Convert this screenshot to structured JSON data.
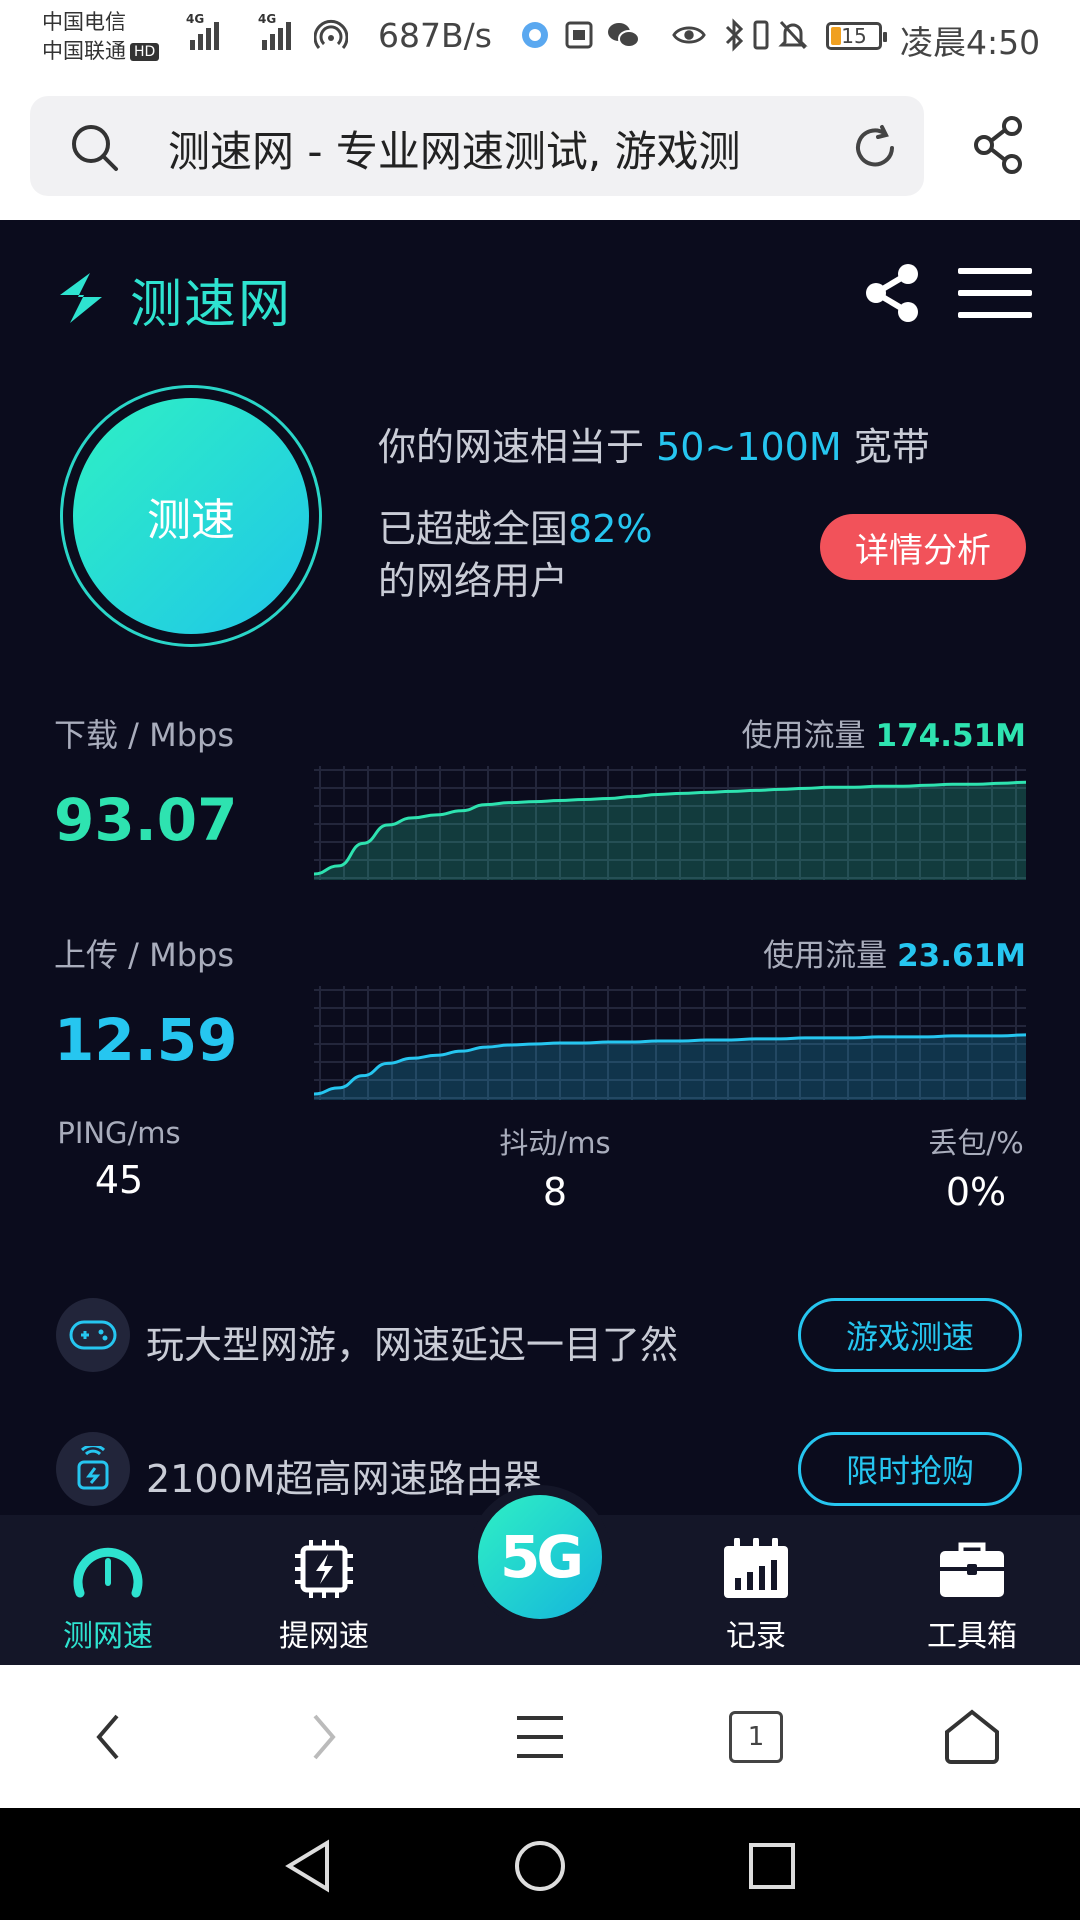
{
  "status_bar": {
    "carrier1": "中国电信",
    "carrier2": "中国联通",
    "hd": "HD",
    "net1": "4G",
    "net2": "4G",
    "speed": "687B/s",
    "battery": "15",
    "time": "凌晨4:50"
  },
  "browser": {
    "url_text": "测速网 - 专业网速测试, 游戏测",
    "tab_count": "1"
  },
  "header": {
    "logo_text": "测速网"
  },
  "summary": {
    "start_button": "测速",
    "rate_prefix": "你的网速相当于",
    "rate_value": "50~100M",
    "rate_suffix": "宽带",
    "beat_prefix": "已超越全国",
    "beat_pct": "82%",
    "beat_suffix": "的网络用户",
    "detail_button": "详情分析"
  },
  "download": {
    "label": "下载 / Mbps",
    "value": "93.07",
    "usage_label": "使用流量",
    "usage_value": "174.51M",
    "color": "#2ee3b0",
    "series": [
      0,
      8,
      30,
      48,
      55,
      58,
      62,
      68,
      70,
      71,
      72,
      73,
      74,
      76,
      78,
      79,
      80,
      81,
      82,
      83,
      84,
      85,
      85,
      86,
      86,
      87,
      88,
      88,
      89,
      90
    ]
  },
  "upload": {
    "label": "上传 / Mbps",
    "value": "12.59",
    "usage_label": "使用流量",
    "usage_value": "23.61M",
    "color": "#26c6f0",
    "series": [
      0,
      6,
      18,
      30,
      35,
      38,
      42,
      46,
      48,
      49,
      50,
      50,
      51,
      51,
      52,
      52,
      53,
      53,
      54,
      54,
      55,
      55,
      55,
      56,
      56,
      56,
      57,
      57,
      57,
      58
    ]
  },
  "stats": {
    "ping_label": "PING/ms",
    "ping_value": "45",
    "jitter_label": "抖动/ms",
    "jitter_value": "8",
    "loss_label": "丢包/%",
    "loss_value": "0%"
  },
  "promos": [
    {
      "text": "玩大型网游，网速延迟一目了然",
      "button": "游戏测速"
    },
    {
      "text": "2100M超高网速路由器",
      "button": "限时抢购"
    }
  ],
  "bottom_nav": {
    "items": [
      "测网速",
      "提网速",
      "记录",
      "工具箱"
    ],
    "center": "5G"
  },
  "colors": {
    "accent_teal": "#2ee3d0",
    "accent_blue": "#26c6f0",
    "detail_red": "#f2525a",
    "page_bg": "#0b0c1d"
  }
}
